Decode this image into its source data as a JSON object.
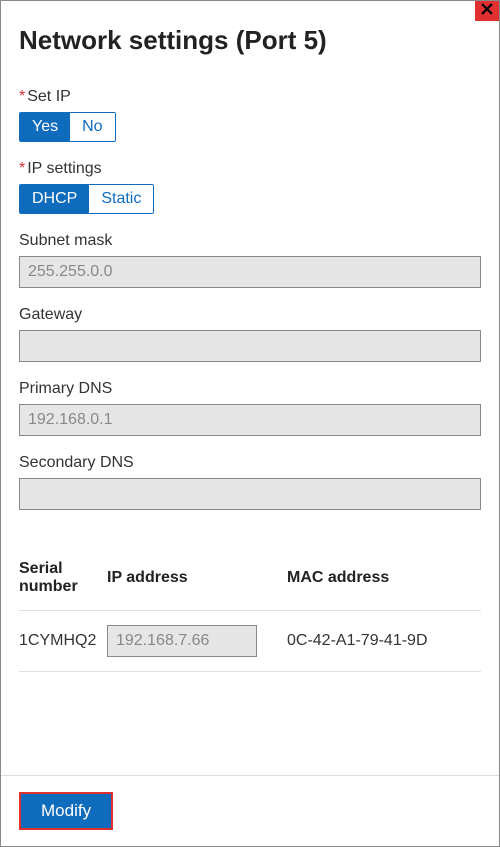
{
  "title": "Network settings (Port 5)",
  "set_ip": {
    "label": "Set IP",
    "option_yes": "Yes",
    "option_no": "No",
    "selected": "Yes"
  },
  "ip_settings": {
    "label": "IP settings",
    "option_dhcp": "DHCP",
    "option_static": "Static",
    "selected": "DHCP"
  },
  "subnet_mask": {
    "label": "Subnet mask",
    "value": "255.255.0.0"
  },
  "gateway": {
    "label": "Gateway",
    "value": ""
  },
  "primary_dns": {
    "label": "Primary DNS",
    "value": "192.168.0.1"
  },
  "secondary_dns": {
    "label": "Secondary DNS",
    "value": ""
  },
  "table": {
    "headers": {
      "serial": "Serial number",
      "ip": "IP address",
      "mac": "MAC address"
    },
    "row": {
      "serial": "1CYMHQ2",
      "ip": "192.168.7.66",
      "mac": "0C-42-A1-79-41-9D"
    }
  },
  "footer": {
    "modify_label": "Modify"
  },
  "required_marker": "*"
}
